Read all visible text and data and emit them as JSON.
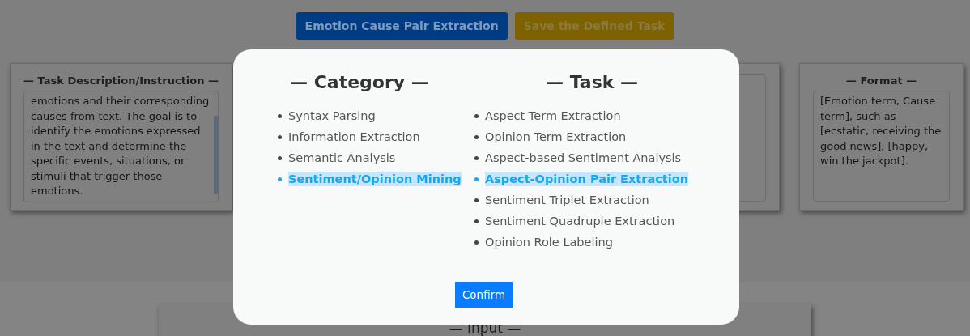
{
  "header_buttons": [
    {
      "label": "Emotion Cause Pair Extraction",
      "kind": "primary"
    },
    {
      "label": "Save the Defined Task",
      "kind": "warning"
    }
  ],
  "panels": [
    {
      "title": "— Task Description/Instruction —",
      "text": "emotions and their corresponding causes from text. The goal is to identify the emotions expressed in the text and determine the specific events, situations, or stimuli that trigger those emotions.",
      "kind": "left"
    },
    {
      "kind": "middle"
    },
    {
      "title": "— Format —",
      "text": "[Emotion term, Cause term], such as [ecstatic, receiving the good news], [happy, win the jackpot].",
      "kind": "right"
    }
  ],
  "input_panel": {
    "title": "— Input —"
  },
  "modal": {
    "category_title": "— Category —",
    "task_title": "— Task —",
    "categories": [
      {
        "label": "Syntax Parsing",
        "selected": false
      },
      {
        "label": "Information Extraction",
        "selected": false
      },
      {
        "label": "Semantic Analysis",
        "selected": false
      },
      {
        "label": "Sentiment/Opinion Mining",
        "selected": true
      }
    ],
    "tasks": [
      {
        "label": "Aspect Term Extraction",
        "selected": false
      },
      {
        "label": "Opinion Term Extraction",
        "selected": false
      },
      {
        "label": "Aspect-based Sentiment Analysis",
        "selected": false
      },
      {
        "label": "Aspect-Opinion Pair Extraction",
        "selected": true
      },
      {
        "label": "Sentiment Triplet Extraction",
        "selected": false
      },
      {
        "label": "Sentiment Quadruple Extraction",
        "selected": false
      },
      {
        "label": "Opinion Role Labeling",
        "selected": false
      }
    ],
    "confirm": "Confirm"
  }
}
